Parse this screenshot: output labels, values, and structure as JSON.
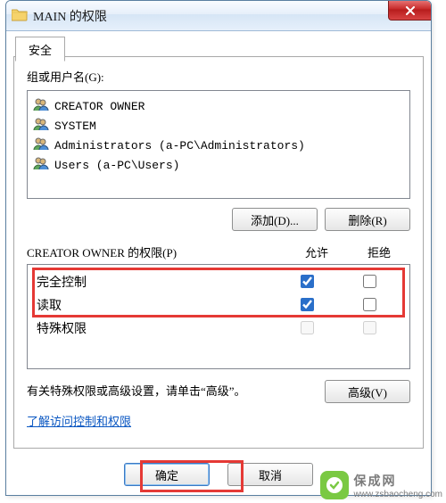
{
  "window": {
    "title": "MAIN 的权限"
  },
  "tab": {
    "label": "安全"
  },
  "group_label": "组或用户名(G):",
  "groups": [
    "CREATOR OWNER",
    "SYSTEM",
    "Administrators (a-PC\\Administrators)",
    "Users (a-PC\\Users)"
  ],
  "buttons": {
    "add": "添加(D)...",
    "remove": "删除(R)",
    "advanced": "高级(V)",
    "ok": "确定",
    "cancel": "取消"
  },
  "perm": {
    "title": "CREATOR OWNER 的权限(P)",
    "allow": "允许",
    "deny": "拒绝",
    "rows": [
      {
        "name": "完全控制",
        "allow": true,
        "deny": false,
        "disabled": false
      },
      {
        "name": "读取",
        "allow": true,
        "deny": false,
        "disabled": false
      },
      {
        "name": "特殊权限",
        "allow": false,
        "deny": false,
        "disabled": true
      }
    ]
  },
  "adv_text": "有关特殊权限或高级设置，请单击“高级”。",
  "link": "了解访问控制和权限",
  "watermark": {
    "text": "保成网",
    "url": "www.zsbaocheng.com"
  }
}
